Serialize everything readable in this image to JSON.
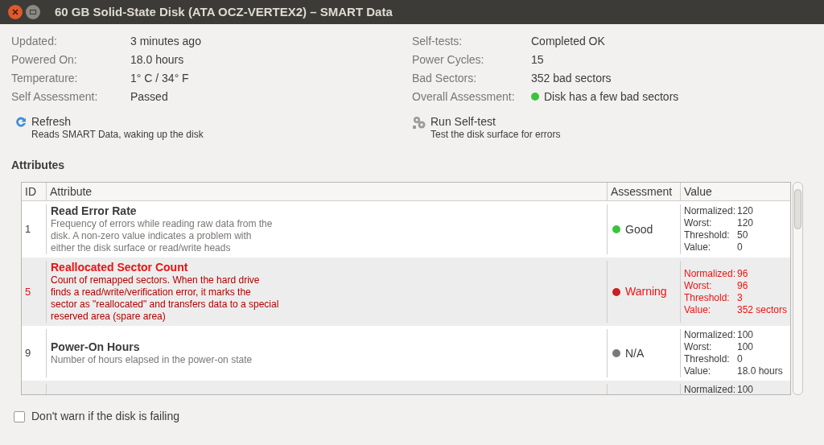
{
  "window": {
    "title": "60 GB Solid-State Disk (ATA OCZ-VERTEX2) – SMART Data"
  },
  "info_left": [
    {
      "label": "Updated:",
      "value": "3 minutes ago"
    },
    {
      "label": "Powered On:",
      "value": "18.0 hours"
    },
    {
      "label": "Temperature:",
      "value": "1° C / 34° F"
    },
    {
      "label": "Self Assessment:",
      "value": "Passed"
    }
  ],
  "info_right": [
    {
      "label": "Self-tests:",
      "value": "Completed OK"
    },
    {
      "label": "Power Cycles:",
      "value": "15"
    },
    {
      "label": "Bad Sectors:",
      "value": "352 bad sectors"
    },
    {
      "label": "Overall Assessment:",
      "value": "Disk has a few bad sectors",
      "color": "#3bc43b"
    }
  ],
  "actions": [
    {
      "kind": "refresh",
      "label": "Refresh",
      "description": "Reads SMART Data, waking up the disk"
    },
    {
      "kind": "selftest",
      "label": "Run Self-test",
      "description": "Test the disk surface for errors"
    }
  ],
  "attributes_heading": "Attributes",
  "table": {
    "columns": [
      "ID",
      "Attribute",
      "Assessment",
      "Value"
    ],
    "rows": [
      {
        "id": "1",
        "name": "Read Error Rate",
        "description": "Frequency of errors while reading raw data from the\ndisk. A non-zero value indicates a problem with\neither the disk surface or read/write heads",
        "assessment": "Good",
        "color": "#3bc43b",
        "warning": false,
        "values": [
          [
            "Normalized:",
            "120"
          ],
          [
            "Worst:",
            "120"
          ],
          [
            "Threshold:",
            "50"
          ],
          [
            "Value:",
            "0"
          ]
        ]
      },
      {
        "id": "5",
        "name": "Reallocated Sector Count",
        "description": "Count of remapped sectors. When the hard drive\nfinds a read/write/verification error, it marks the\nsector as \"reallocated\" and transfers data to a special\nreserved area (spare area)",
        "assessment": "Warning",
        "color": "#cc1f1f",
        "warning": true,
        "values": [
          [
            "Normalized:",
            "96"
          ],
          [
            "Worst:",
            "96"
          ],
          [
            "Threshold:",
            "3"
          ],
          [
            "Value:",
            "352 sectors"
          ]
        ]
      },
      {
        "id": "9",
        "name": "Power-On Hours",
        "description": "Number of hours elapsed in the power-on state",
        "assessment": "N/A",
        "color": "#7a7a7a",
        "warning": false,
        "values": [
          [
            "Normalized:",
            "100"
          ],
          [
            "Worst:",
            "100"
          ],
          [
            "Threshold:",
            "0"
          ],
          [
            "Value:",
            "18.0 hours"
          ]
        ]
      },
      {
        "values": [
          [
            "Normalized:",
            "100"
          ]
        ],
        "warning": false
      }
    ]
  },
  "checkbox": {
    "label": "Don't warn if the disk is failing",
    "checked": false
  }
}
